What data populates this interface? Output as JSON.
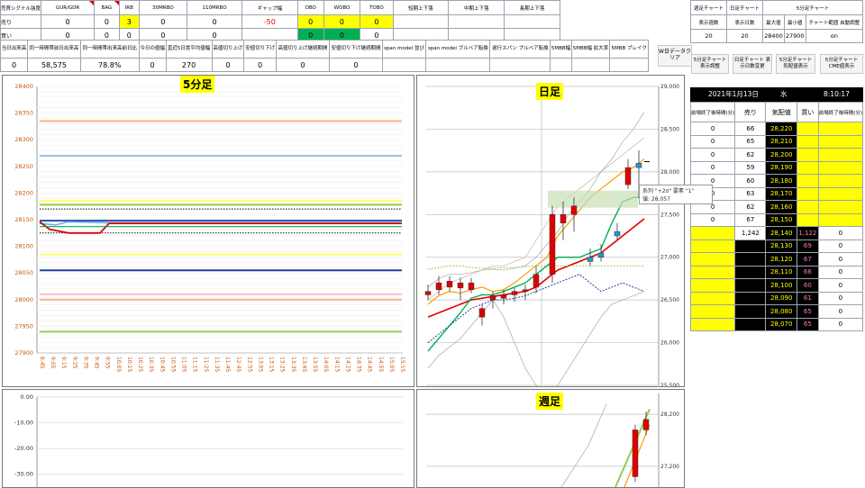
{
  "signal_table": {
    "label_header": "売買シグナル強度",
    "row_labels": [
      "売り",
      "買い"
    ],
    "columns": [
      {
        "header": "GUR/GDR",
        "sell": "0",
        "buy": "0",
        "flag": true
      },
      {
        "header": "BAG",
        "sell": "0",
        "buy": "0",
        "flag": true
      },
      {
        "header": "IRB",
        "sell": "3",
        "buy": "0",
        "sell_color": "yellow"
      },
      {
        "header": "30MRBO",
        "sell": "0",
        "buy": "0"
      },
      {
        "header": "110MRBO",
        "sell": "0",
        "buy": "0"
      },
      {
        "header": "ギャップ幅",
        "sell": "-50",
        "buy": "",
        "sell_red": true
      },
      {
        "header": "OBO",
        "sell": "0",
        "buy": "0",
        "sell_color": "yellow",
        "buy_color": "green"
      },
      {
        "header": "WOBO",
        "sell": "0",
        "buy": "0",
        "sell_color": "yellow",
        "buy_color": "green"
      },
      {
        "header": "TOBO",
        "sell": "0",
        "buy": "0",
        "sell_color": "yellow"
      },
      {
        "header": "短期上下落",
        "sell": "",
        "buy": ""
      },
      {
        "header": "中期上下落",
        "sell": "",
        "buy": ""
      },
      {
        "header": "長期上下落",
        "sell": "",
        "buy": ""
      }
    ]
  },
  "stats_table": {
    "headers": [
      "当日出来高",
      "同一時間帯前日出来高",
      "同一時間帯出来高前日比",
      "今日の値幅",
      "直近5日営平均値幅",
      "高値切り上げ",
      "安値切り下げ",
      "高値切り上げ継続期間",
      "安値切り下げ継続期間",
      "span model 並び",
      "span model ブルベア転換",
      "遅行スパン ブルベア転換",
      "5MBB幅",
      "5MBB幅 拡大率",
      "5MBB ブレイク"
    ],
    "values": [
      "0",
      "58,575",
      "78.8%",
      "0",
      "270",
      "0",
      "0",
      "0",
      "0",
      "",
      "",
      "",
      "",
      "",
      ""
    ]
  },
  "chart_settings": {
    "headers": [
      "週足チャート",
      "日足チャート",
      "5分足チャート"
    ],
    "sub_headers": [
      "表示週数",
      "表示日数",
      "最大値",
      "最小値",
      "チャート範囲 自動調整"
    ],
    "values": [
      "20",
      "20",
      "28400",
      "27900",
      "on"
    ]
  },
  "buttons": {
    "clear": "W日データクリア",
    "five_min_adjust": "5分足チャート 表示調整",
    "daily_days": "日足チャート 表示日数変更",
    "five_min_quote": "5分足チャート 気配値表示",
    "five_min_cme": "5分足チャート CME値表示"
  },
  "order_book": {
    "date": "2021年1月13日",
    "weekday": "水",
    "time": "8:10:17",
    "headers": [
      "前場終了後時間(分)",
      "売り",
      "気配値",
      "買い",
      "前場終了後時間(分)"
    ],
    "rows": [
      {
        "l": "0",
        "sell": "66",
        "price": "28,220",
        "buy": "",
        "r": ""
      },
      {
        "l": "0",
        "sell": "65",
        "price": "28,210",
        "buy": "",
        "r": ""
      },
      {
        "l": "0",
        "sell": "62",
        "price": "28,200",
        "buy": "",
        "r": ""
      },
      {
        "l": "0",
        "sell": "59",
        "price": "28,190",
        "buy": "",
        "r": ""
      },
      {
        "l": "0",
        "sell": "60",
        "price": "28,180",
        "buy": "",
        "r": ""
      },
      {
        "l": "0",
        "sell": "63",
        "price": "28,170",
        "buy": "",
        "r": ""
      },
      {
        "l": "0",
        "sell": "62",
        "price": "28,160",
        "buy": "",
        "r": ""
      },
      {
        "l": "0",
        "sell": "67",
        "price": "28,150",
        "buy": "",
        "r": ""
      },
      {
        "l": "",
        "sell": "1,242",
        "price": "28,140",
        "buy": "1,122",
        "r": "0"
      },
      {
        "l": "",
        "sell": "",
        "price": "28,130",
        "buy": "69",
        "r": "0"
      },
      {
        "l": "",
        "sell": "",
        "price": "28,120",
        "buy": "67",
        "r": "0"
      },
      {
        "l": "",
        "sell": "",
        "price": "28,110",
        "buy": "66",
        "r": "0"
      },
      {
        "l": "",
        "sell": "",
        "price": "28,100",
        "buy": "60",
        "r": "0"
      },
      {
        "l": "",
        "sell": "",
        "price": "28,090",
        "buy": "61",
        "r": "0"
      },
      {
        "l": "",
        "sell": "",
        "price": "28,080",
        "buy": "65",
        "r": "0"
      },
      {
        "l": "",
        "sell": "",
        "price": "28,070",
        "buy": "65",
        "r": "0"
      }
    ]
  },
  "tooltip": {
    "line1": "系列 \"+2σ\" 要素 \"1\"",
    "line2": "値: 28,057"
  },
  "chart_data": [
    {
      "type": "line",
      "title": "5分足",
      "yticks": [
        "28400",
        "28350",
        "28300",
        "28250",
        "28200",
        "28150",
        "28100",
        "28050",
        "28000",
        "27950",
        "27900"
      ],
      "ylim": [
        27900,
        28400
      ],
      "xticks": [
        "8:45",
        "9:05",
        "9:15",
        "9:25",
        "9:35",
        "9:45",
        "9:55",
        "10:05",
        "10:15",
        "10:25",
        "10:35",
        "10:45",
        "10:55",
        "11:05",
        "11:15",
        "11:25",
        "11:35",
        "11:45",
        "12:45",
        "12:55",
        "13:05",
        "13:15",
        "13:25",
        "13:35",
        "13:45",
        "13:55",
        "14:05",
        "14:15",
        "14:25",
        "14:35",
        "14:45",
        "14:55",
        "15:05",
        "15:15"
      ],
      "hlines": [
        {
          "value": 28335,
          "color": "#f4b183"
        },
        {
          "value": 28270,
          "color": "#9dc3e6"
        },
        {
          "value": 28185,
          "color": "#ffff66"
        },
        {
          "value": 28178,
          "color": "#92d050"
        },
        {
          "value": 28170,
          "color": "#000000",
          "dotted": true
        },
        {
          "value": 28125,
          "color": "#000000",
          "dotted": true
        },
        {
          "value": 28085,
          "color": "#ffff66"
        },
        {
          "value": 28055,
          "color": "#1f3fa0"
        },
        {
          "value": 28010,
          "color": "#ffc0cb"
        },
        {
          "value": 28000,
          "color": "#f4b183"
        },
        {
          "value": 27940,
          "color": "#92d050"
        }
      ]
    },
    {
      "type": "line",
      "title": "日足",
      "yticks": [
        "29,000",
        "28,500",
        "28,000",
        "27,500",
        "27,000",
        "26,500",
        "26,000",
        "25,500"
      ],
      "ylim": [
        25500,
        29000
      ]
    },
    {
      "type": "line",
      "title": "",
      "yticks": [
        "0.00",
        "-10.00",
        "-20.00",
        "-30.00"
      ],
      "ylim": [
        -35,
        0
      ]
    },
    {
      "type": "line",
      "title": "週足",
      "yticks": [
        "28,200",
        "27,200"
      ],
      "ylim": [
        26800,
        28600
      ]
    }
  ]
}
